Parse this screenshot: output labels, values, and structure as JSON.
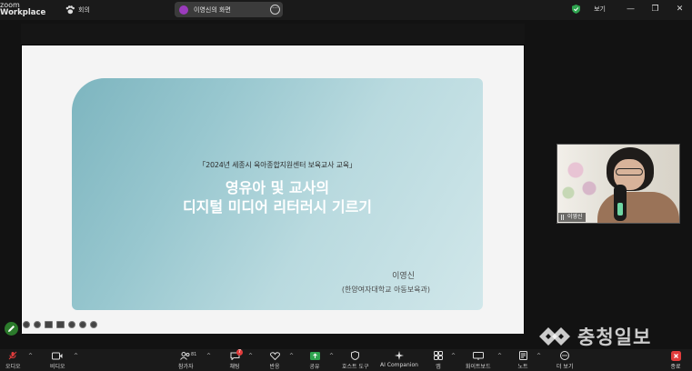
{
  "app": {
    "brand_line1": "zoom",
    "brand_line2": "Workplace"
  },
  "topbar": {
    "meetings_label": "회의",
    "share_title": "이영신의 화면",
    "view_label": "보기",
    "window_controls": [
      "—",
      "❐",
      "✕"
    ]
  },
  "slide": {
    "subtitle": "「2024년 세종시 육아종합지원센터 보육교사 교육」",
    "title_line1": "영유아 및 교사의",
    "title_line2": "디지털 미디어 리터러시 기르기",
    "author": "이영신",
    "affiliation": "(한양여자대학교 아동보육과)"
  },
  "video": {
    "participant_name": "이영신"
  },
  "watermark": {
    "text": "충청일보"
  },
  "toolbar": {
    "audio": "오디오",
    "video": "비디오",
    "participants": "참가자",
    "participant_count": "81",
    "chat": "채팅",
    "chat_badge": "7",
    "reactions": "반응",
    "share": "공유",
    "host_tools": "호스트 도구",
    "ai_companion": "AI Companion",
    "apps": "앱",
    "whiteboard": "화이트보드",
    "notes": "노트",
    "more": "더 보기",
    "end": "종료"
  },
  "colors": {
    "accent_green": "#2ea44f",
    "end_red": "#e13c3c",
    "slide_card_start": "#7db5bf",
    "slide_card_end": "#d1e7ea"
  }
}
